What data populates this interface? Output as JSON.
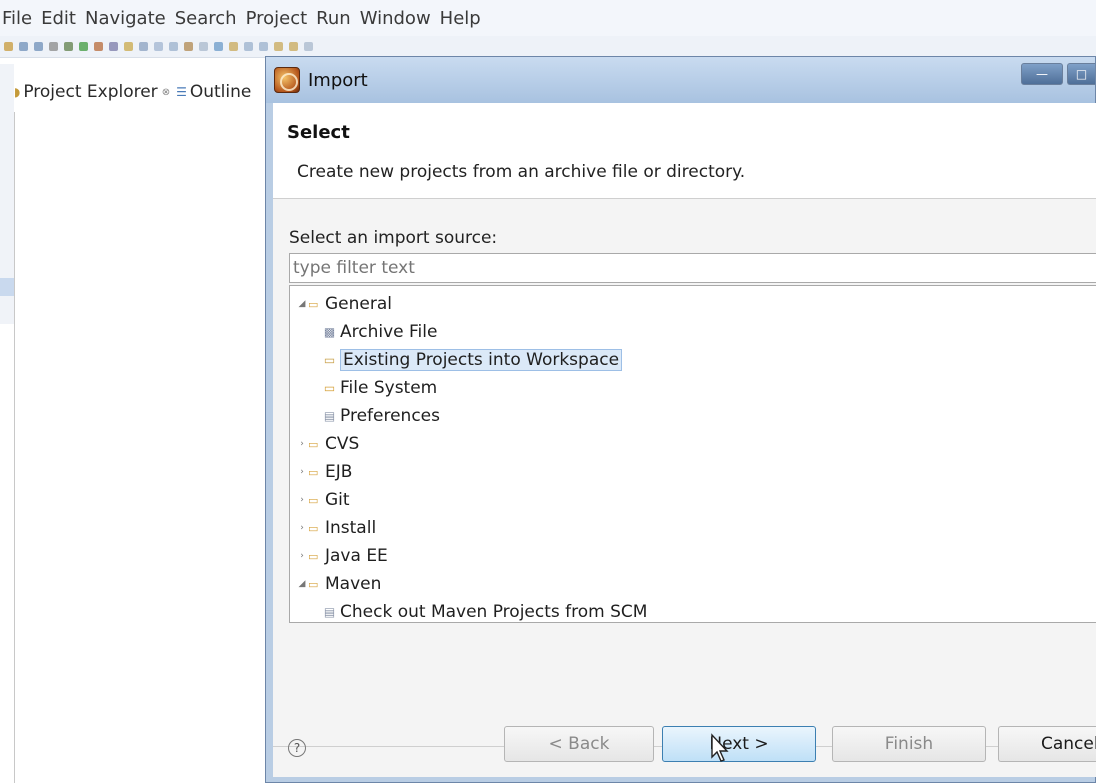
{
  "menubar": {
    "items": [
      "File",
      "Edit",
      "Navigate",
      "Search",
      "Project",
      "Run",
      "Window",
      "Help"
    ]
  },
  "views": {
    "project_explorer": "Project Explorer",
    "outline": "Outline",
    "close_glyph": "⊗"
  },
  "dialog": {
    "title": "Import",
    "banner_title": "Select",
    "banner_description": "Create new projects from an archive file or directory.",
    "source_label": "Select an import source:",
    "filter_placeholder": "type filter text",
    "tree": [
      {
        "label": "General",
        "expanded": true,
        "children": [
          {
            "label": "Archive File",
            "icon": "archive-file-icon"
          },
          {
            "label": "Existing Projects into Workspace",
            "icon": "existing-projects-icon",
            "selected": true
          },
          {
            "label": "File System",
            "icon": "file-system-icon"
          },
          {
            "label": "Preferences",
            "icon": "preferences-icon"
          }
        ]
      },
      {
        "label": "CVS",
        "expanded": false
      },
      {
        "label": "EJB",
        "expanded": false
      },
      {
        "label": "Git",
        "expanded": false
      },
      {
        "label": "Install",
        "expanded": false
      },
      {
        "label": "Java EE",
        "expanded": false
      },
      {
        "label": "Maven",
        "expanded": true,
        "children": [
          {
            "label": "Check out Maven Projects from SCM",
            "icon": "maven-scm-icon"
          }
        ]
      }
    ],
    "buttons": {
      "help": "?",
      "back": "< Back",
      "next": "Next >",
      "finish": "Finish",
      "cancel": "Cancel"
    }
  },
  "colors": {
    "selection_bg": "#dbe9f8",
    "folder": "#d6a23c",
    "default_button": "#bfe0f7"
  }
}
